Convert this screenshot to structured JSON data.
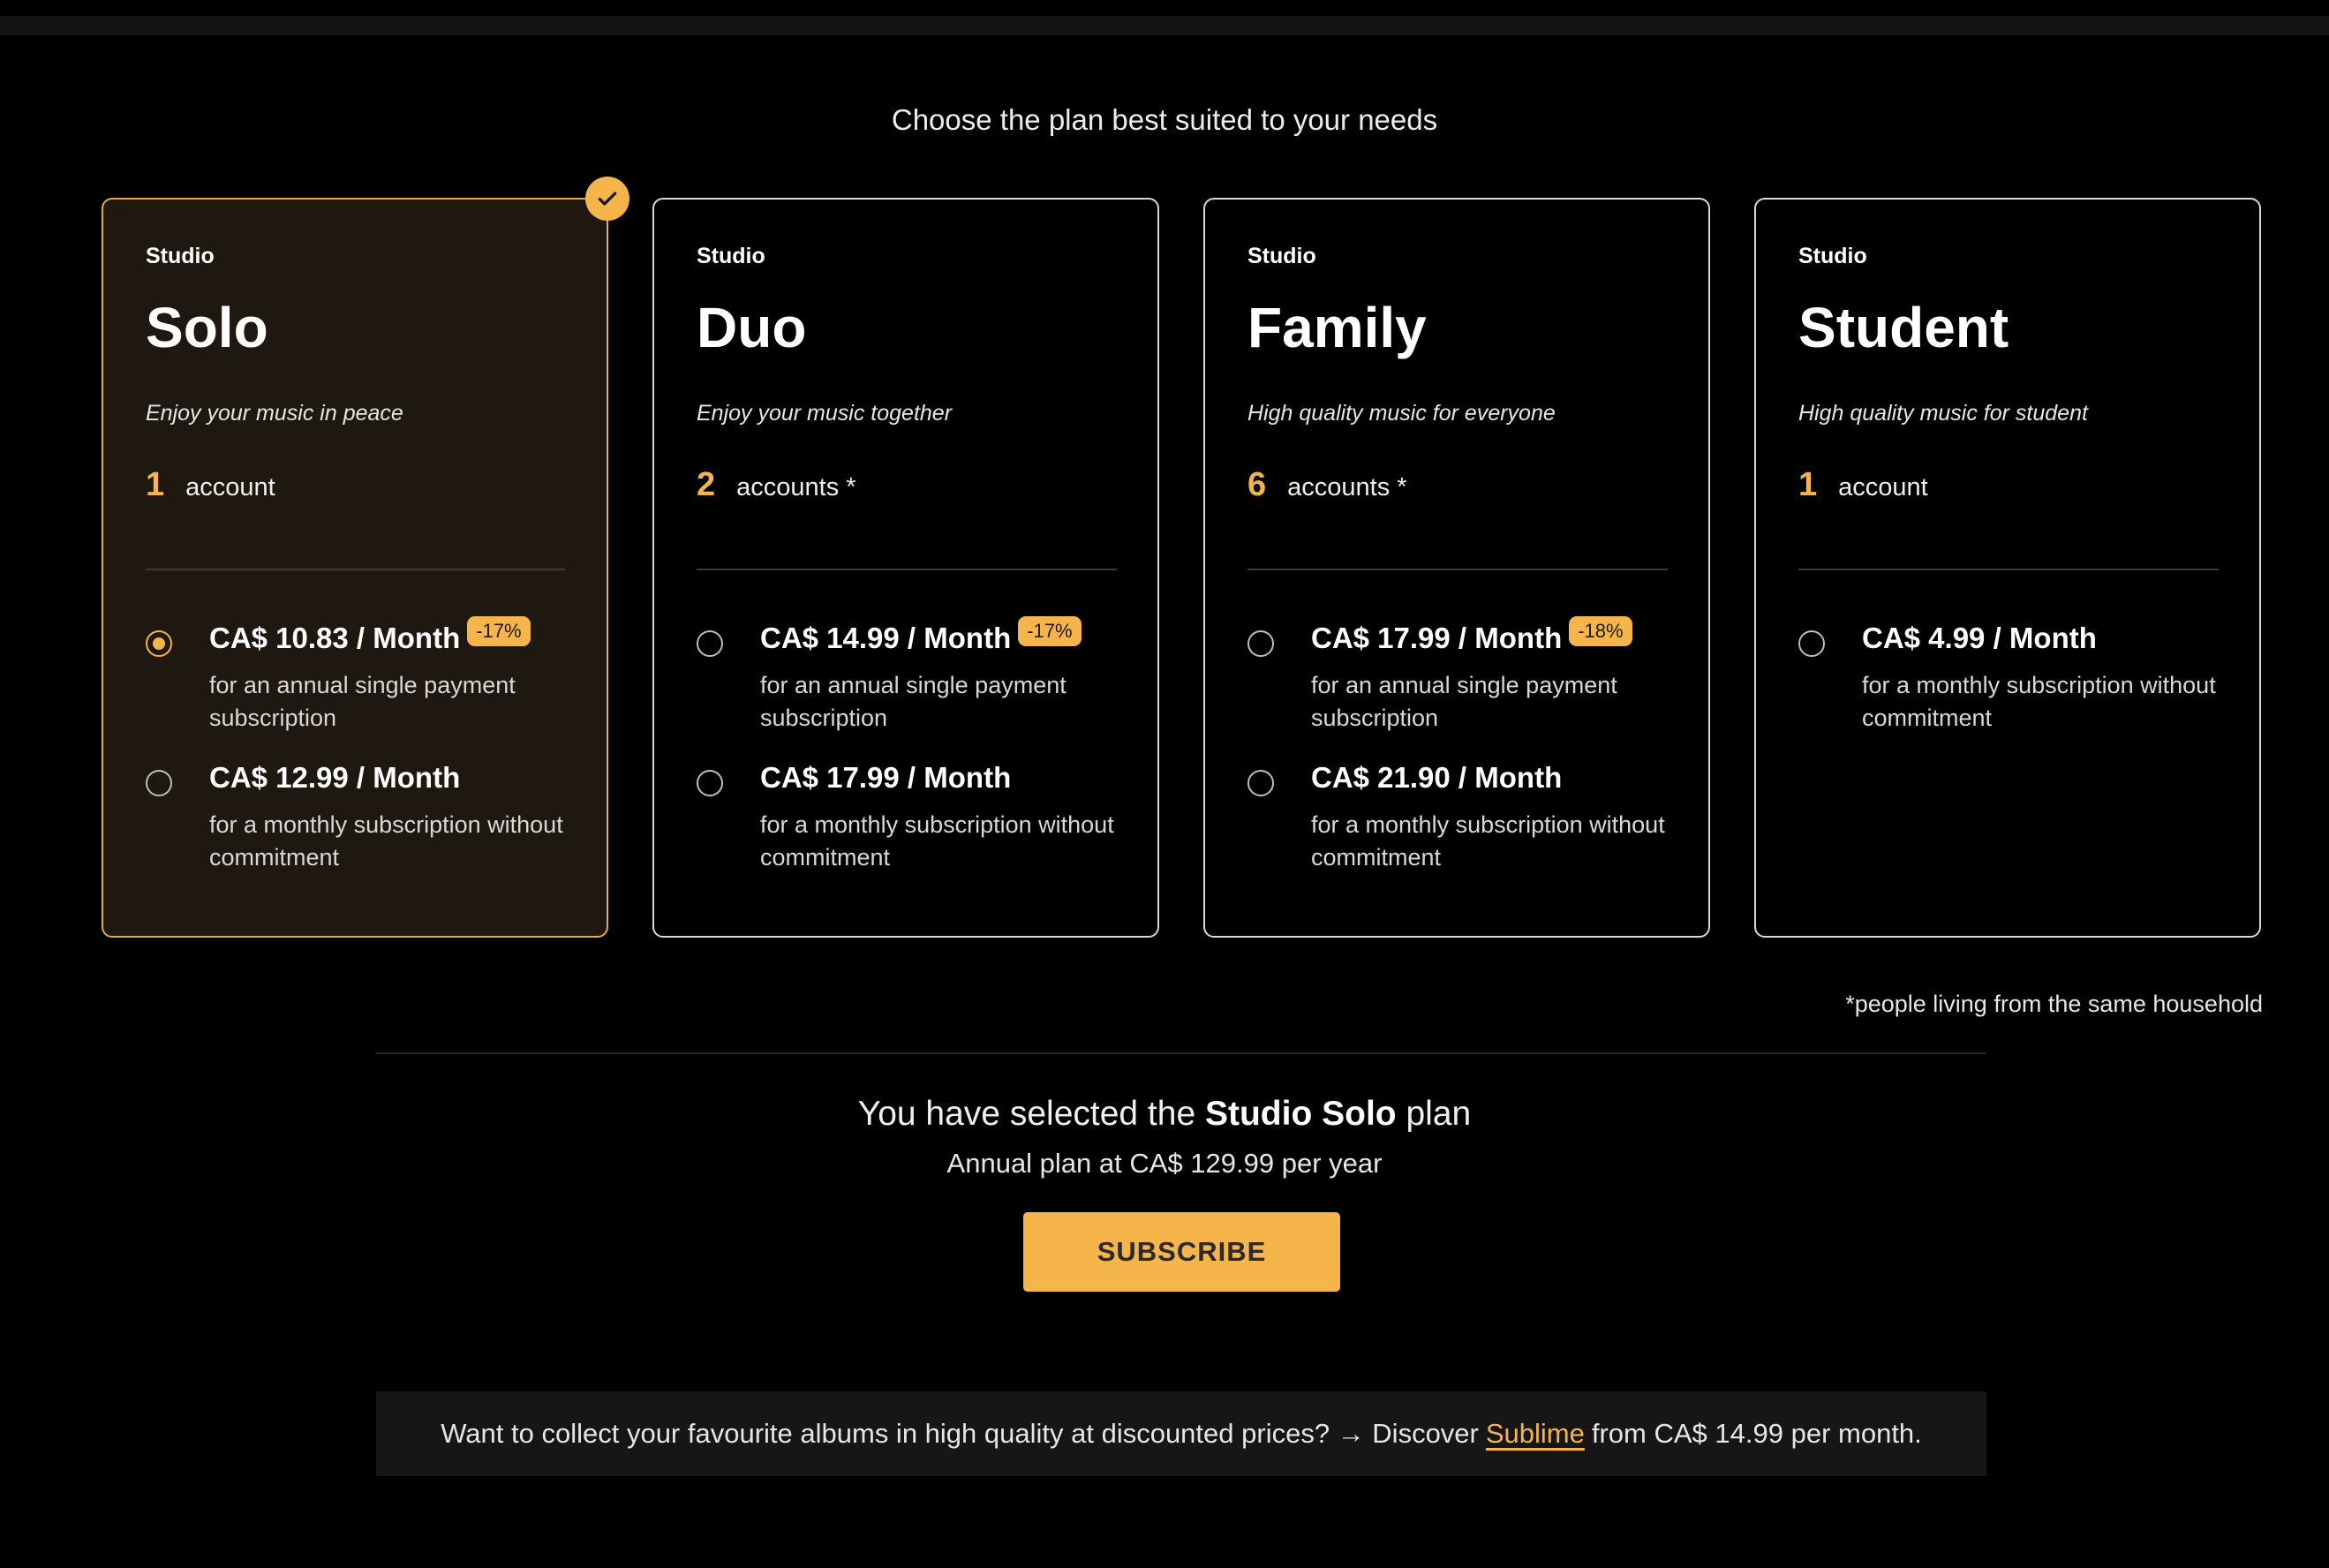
{
  "header": {
    "title": "Choose the plan best suited to your needs"
  },
  "plans": [
    {
      "tier": "Studio",
      "name": "Solo",
      "tagline": "Enjoy your music in peace",
      "accounts_count": "1",
      "accounts_label": "account",
      "selected": true,
      "options": [
        {
          "price": "CA$ 10.83 / Month",
          "discount": "-17%",
          "desc": "for an annual single payment subscription",
          "checked": true
        },
        {
          "price": "CA$ 12.99 / Month",
          "desc": "for a monthly subscription without commitment",
          "checked": false
        }
      ]
    },
    {
      "tier": "Studio",
      "name": "Duo",
      "tagline": "Enjoy your music together",
      "accounts_count": "2",
      "accounts_label": "accounts *",
      "selected": false,
      "options": [
        {
          "price": "CA$ 14.99 / Month",
          "discount": "-17%",
          "desc": "for an annual single payment subscription",
          "checked": false
        },
        {
          "price": "CA$ 17.99 / Month",
          "desc": "for a monthly subscription without commitment",
          "checked": false
        }
      ]
    },
    {
      "tier": "Studio",
      "name": "Family",
      "tagline": "High quality music for everyone",
      "accounts_count": "6",
      "accounts_label": "accounts *",
      "selected": false,
      "options": [
        {
          "price": "CA$ 17.99 / Month",
          "discount": "-18%",
          "desc": "for an annual single payment subscription",
          "checked": false
        },
        {
          "price": "CA$ 21.90 / Month",
          "desc": "for a monthly subscription without commitment",
          "checked": false
        }
      ]
    },
    {
      "tier": "Studio",
      "name": "Student",
      "tagline": "High quality music for student",
      "accounts_count": "1",
      "accounts_label": "account",
      "selected": false,
      "options": [
        {
          "price": "CA$ 4.99 / Month",
          "desc": "for a monthly subscription without commitment",
          "checked": false
        }
      ]
    }
  ],
  "footnote": "*people living from the same household",
  "selection": {
    "prefix": "You have selected the ",
    "plan": "Studio Solo",
    "suffix": " plan",
    "annual": "Annual plan at CA$ 129.99 per year"
  },
  "subscribe_label": "SUBSCRIBE",
  "promo": {
    "prefix": "Want to collect your favourite albums in high quality at discounted prices? → Discover",
    "link": "Sublime",
    "suffix": "from CA$ 14.99 per month."
  },
  "colors": {
    "accent": "#f5b54a",
    "selected_bg": "#1f1810",
    "background": "#000000"
  },
  "icons": {
    "selected_badge": "check-icon"
  }
}
